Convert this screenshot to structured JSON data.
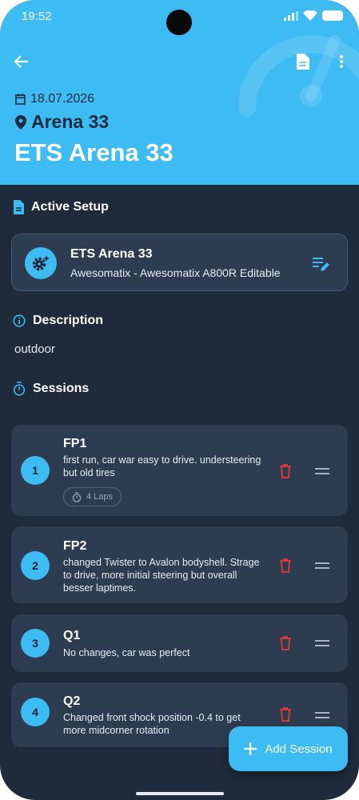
{
  "status_bar": {
    "time": "19:52"
  },
  "header": {
    "date": "18.07.2026",
    "track": "Arena 33",
    "event_title": "ETS Arena 33"
  },
  "active_setup": {
    "section_title": "Active Setup",
    "name": "ETS Arena 33",
    "subtitle": "Awesomatix - Awesomatix A800R Editable"
  },
  "description": {
    "section_title": "Description",
    "text": "outdoor"
  },
  "sessions": {
    "section_title": "Sessions",
    "items": [
      {
        "number": "1",
        "name": "FP1",
        "notes": "first run, car war easy to drive. understeering but old tires",
        "laps": "4 Laps"
      },
      {
        "number": "2",
        "name": "FP2",
        "notes": "changed Twister to Avalon bodyshell. Strage to drive, more initial steering but overall besser laptimes."
      },
      {
        "number": "3",
        "name": "Q1",
        "notes": "No changes, car was perfect"
      },
      {
        "number": "4",
        "name": "Q2",
        "notes": "Changed front shock position -0.4 to get more midcorner rotation"
      }
    ]
  },
  "fab": {
    "label": "Add Session"
  },
  "colors": {
    "accent": "#3dbbf3",
    "background": "#1f2a3a",
    "card": "#2d3c50",
    "delete": "#e53935"
  }
}
